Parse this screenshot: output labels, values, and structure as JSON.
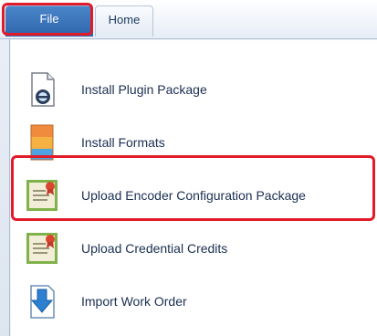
{
  "tabs": [
    {
      "label": "File",
      "active": true
    },
    {
      "label": "Home",
      "active": false
    }
  ],
  "menu": {
    "items": [
      {
        "label": "Install Plugin Package",
        "icon": "install-plugin-icon"
      },
      {
        "label": "Install Formats",
        "icon": "install-formats-icon"
      },
      {
        "label": "Upload Encoder Configuration Package",
        "icon": "certificate-icon",
        "highlighted": true
      },
      {
        "label": "Upload Credential Credits",
        "icon": "certificate-icon"
      },
      {
        "label": "Import Work Order",
        "icon": "import-arrow-icon"
      }
    ]
  },
  "colors": {
    "highlight": "#e11b2a",
    "file_tab": "#2f66ad",
    "text": "#1b2f52"
  }
}
